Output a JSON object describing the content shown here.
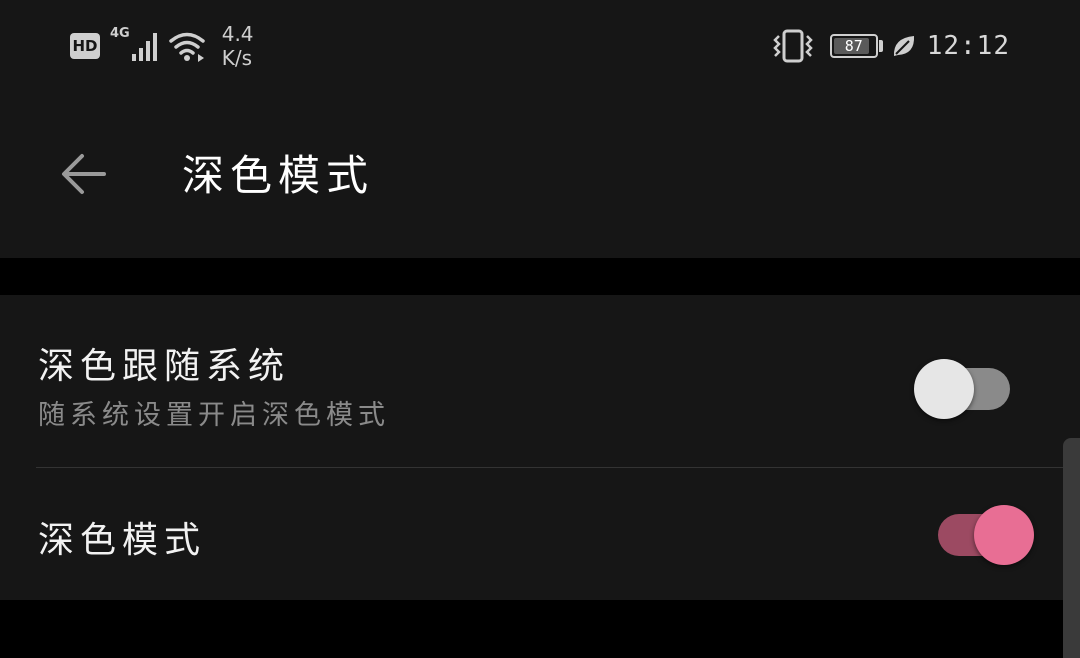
{
  "status_bar": {
    "hd_label": "HD",
    "network_type": "4G",
    "speed_value": "4.4",
    "speed_unit": "K/s",
    "battery_level": "87",
    "battery_fraction": 0.87,
    "time": "12:12",
    "icons": [
      "signal-icon",
      "wifi-icon",
      "vibrate-icon",
      "battery-icon",
      "leaf-icon"
    ]
  },
  "header": {
    "title": "深色模式",
    "back_icon": "back-arrow-icon"
  },
  "settings": {
    "items": [
      {
        "title": "深色跟随系统",
        "subtitle": "随系统设置开启深色模式",
        "enabled": false
      },
      {
        "title": "深色模式",
        "enabled": true
      }
    ]
  },
  "colors": {
    "background": "#000000",
    "surface": "#161616",
    "accent": "#e86e94",
    "accent_track": "#9c4a62",
    "switch_off_thumb": "#e6e6e6",
    "switch_off_track": "#8a8a8a"
  }
}
